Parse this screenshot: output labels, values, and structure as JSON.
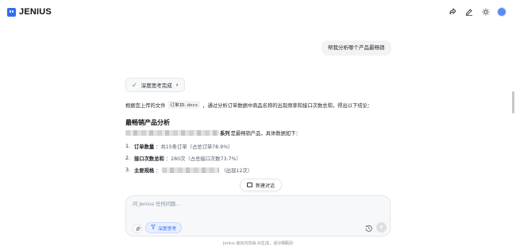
{
  "app": {
    "logo_text": "JENIUS"
  },
  "header_icons": [
    "share-icon",
    "edit-icon",
    "theme-icon",
    "avatar"
  ],
  "user_message": "帮我分析哪个产品最畅销",
  "deep_think": {
    "label": "深度思考完成"
  },
  "answer": {
    "intro_prefix": "根据您上传的文件",
    "file_name": "订单ID.docx",
    "intro_suffix": "，通过分析订单数据中商品名称的出现频率和接口次数总和，得出以下结论：",
    "section_title": "最畅销产品分析",
    "best_line_suffix_bold": "系列",
    "best_line_suffix": "是最畅销产品，具体数据如下：",
    "items": [
      {
        "num": "1.",
        "label": "订单数量",
        "value": "：共15条订单（占总订单78.9%）"
      },
      {
        "num": "2.",
        "label": "接口次数总和",
        "value": "：280次（占总接口次数73.7%）"
      },
      {
        "num": "3.",
        "label": "主要规格",
        "value": "：",
        "tail": "（出现12次）"
      }
    ]
  },
  "new_chat_label": "新建对话",
  "composer": {
    "placeholder": "问 Jenius 任何问题...",
    "deep_think_label": "深度思考"
  },
  "footer_note": "Jenius 输出内容由 AI生成，请仔细甄别",
  "colors": {
    "accent": "#2f6df6",
    "check": "#2a9d4c"
  }
}
